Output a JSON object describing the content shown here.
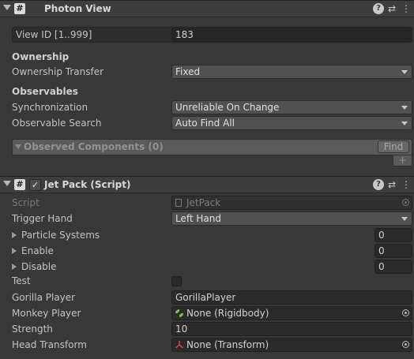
{
  "photon_view": {
    "title": "Photon View",
    "view_id_label": "View ID [1..999]",
    "view_id_value": "183",
    "ownership_heading": "Ownership",
    "ownership_transfer_label": "Ownership Transfer",
    "ownership_transfer_value": "Fixed",
    "observables_heading": "Observables",
    "synchronization_label": "Synchronization",
    "synchronization_value": "Unreliable On Change",
    "observable_search_label": "Observable Search",
    "observable_search_value": "Auto Find All",
    "observed_components_label": "Observed Components (0)",
    "find_button": "Find",
    "add_button": "+"
  },
  "jet_pack": {
    "title": "Jet Pack (Script)",
    "enabled": true,
    "script_label": "Script",
    "script_value": "JetPack",
    "trigger_hand_label": "Trigger Hand",
    "trigger_hand_value": "Left Hand",
    "particle_systems_label": "Particle Systems",
    "particle_systems_size": "0",
    "enable_label": "Enable",
    "enable_size": "0",
    "disable_label": "Disable",
    "disable_size": "0",
    "test_label": "Test",
    "test_checked": false,
    "gorilla_player_label": "Gorilla Player",
    "gorilla_player_value": "GorillaPlayer",
    "monkey_player_label": "Monkey Player",
    "monkey_player_value": "None (Rigidbody)",
    "strength_label": "Strength",
    "strength_value": "10",
    "head_transform_label": "Head Transform",
    "head_transform_value": "None (Transform)"
  },
  "icons": {
    "script": "hash-icon",
    "help": "help-icon",
    "presets": "sliders-icon",
    "menu": "kebab-menu-icon"
  }
}
